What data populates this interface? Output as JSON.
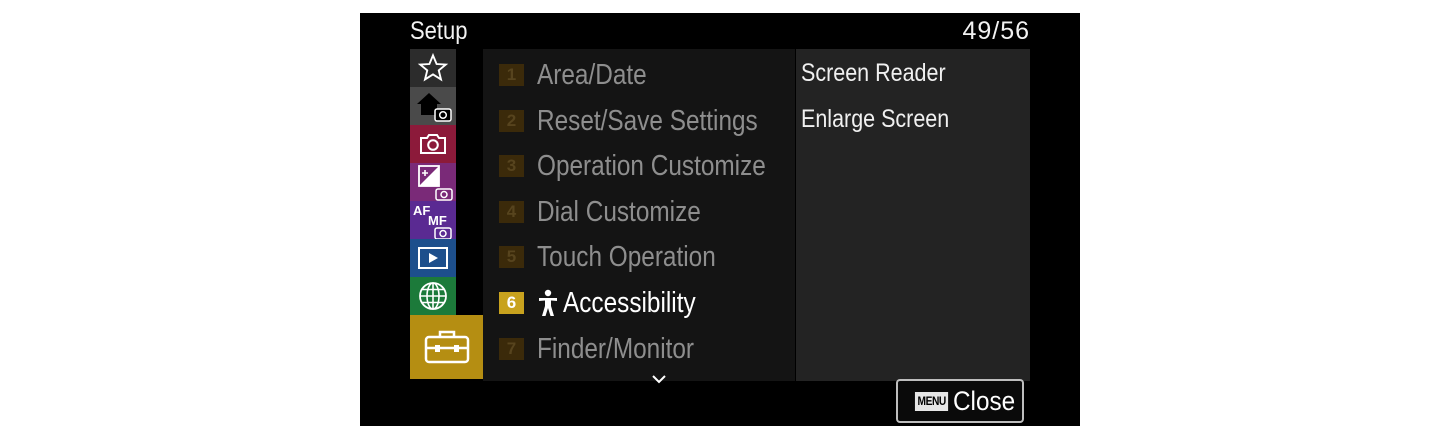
{
  "header": {
    "title": "Setup",
    "page_indicator": "49/56"
  },
  "sidebar": {
    "tabs": [
      {
        "name": "favorites",
        "icon": "star-icon",
        "color": "#2c2c2c"
      },
      {
        "name": "main-shooting",
        "icon": "home-camera-icon",
        "color": "#4a4a4a"
      },
      {
        "name": "shooting",
        "icon": "camera-icon",
        "color": "#8c1a3a"
      },
      {
        "name": "exposure-color",
        "icon": "exposure-camera-icon",
        "color": "#7a2a78"
      },
      {
        "name": "focus",
        "icon": "af-mf-camera-icon",
        "color": "#5a2a92"
      },
      {
        "name": "playback",
        "icon": "play-icon",
        "color": "#1d4f8c"
      },
      {
        "name": "network",
        "icon": "globe-icon",
        "color": "#1c7a3a"
      },
      {
        "name": "setup",
        "icon": "toolbox-icon",
        "color": "#b58e12",
        "active": true
      }
    ]
  },
  "menu": {
    "items": [
      {
        "num": "1",
        "label": "Area/Date"
      },
      {
        "num": "2",
        "label": "Reset/Save Settings"
      },
      {
        "num": "3",
        "label": "Operation Customize"
      },
      {
        "num": "4",
        "label": "Dial Customize"
      },
      {
        "num": "5",
        "label": "Touch Operation"
      },
      {
        "num": "6",
        "label": "Accessibility",
        "active": true,
        "icon": "accessibility-icon"
      },
      {
        "num": "7",
        "label": "Finder/Monitor"
      }
    ],
    "more_icon": "chevron-down-icon"
  },
  "submenu": {
    "items": [
      "Screen Reader",
      "Enlarge Screen"
    ]
  },
  "footer": {
    "menu_key": "MENU",
    "close_label": "Close"
  },
  "colors": {
    "accent": "#c8a21e",
    "background": "#000000",
    "panel": "#141414",
    "subpanel": "#232323"
  }
}
